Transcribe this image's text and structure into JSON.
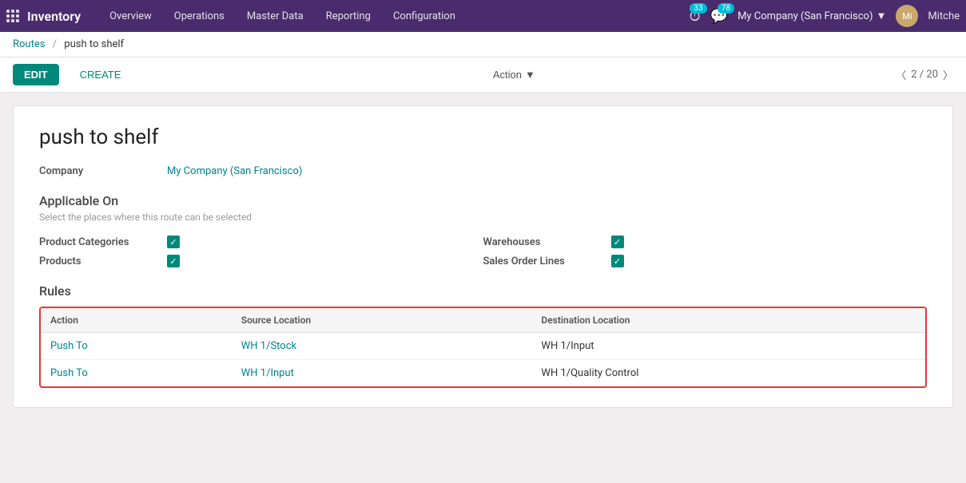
{
  "topbar": {
    "app_name": "Inventory",
    "nav_items": [
      "Overview",
      "Operations",
      "Master Data",
      "Reporting",
      "Configuration"
    ],
    "badge_clock": "33",
    "badge_chat": "78",
    "company_name": "My Company (San Francisco)",
    "user_initials": "Mi",
    "user_name": "Mitche"
  },
  "breadcrumb": {
    "parent": "Routes",
    "separator": "/",
    "current": "push to shelf"
  },
  "toolbar": {
    "edit_label": "EDIT",
    "create_label": "CREATE",
    "action_label": "Action",
    "pager": "2 / 20"
  },
  "form": {
    "title": "push to shelf",
    "company_label": "Company",
    "company_value": "My Company (San Francisco)",
    "applicable_on_title": "Applicable On",
    "applicable_on_subtitle": "Select the places where this route can be selected",
    "checkboxes_left": [
      {
        "label": "Product Categories",
        "checked": true
      },
      {
        "label": "Products",
        "checked": true
      }
    ],
    "checkboxes_right": [
      {
        "label": "Warehouses",
        "checked": true
      },
      {
        "label": "Sales Order Lines",
        "checked": true
      }
    ],
    "rules_title": "Rules",
    "rules_columns": [
      "Action",
      "Source Location",
      "Destination Location"
    ],
    "rules_rows": [
      {
        "action": "Push To",
        "source": "WH 1/Stock",
        "destination": "WH 1/Input"
      },
      {
        "action": "Push To",
        "source": "WH 1/Input",
        "destination": "WH 1/Quality Control"
      }
    ]
  }
}
